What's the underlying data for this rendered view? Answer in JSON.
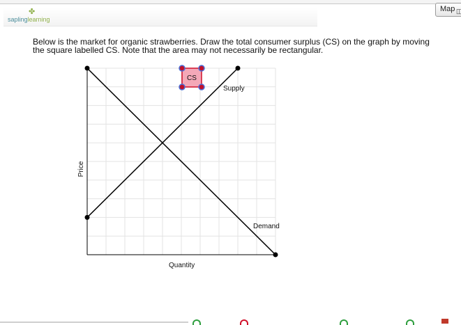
{
  "header": {
    "logo_main": "sapling",
    "logo_accent": "learning",
    "map_button_label": "Map"
  },
  "question": {
    "text": "Below is the market for organic strawberries. Draw the total consumer surplus (CS) on the graph by moving the square labelled CS. Note that the area may not necessarily be rectangular."
  },
  "graph": {
    "x_axis_label": "Quantity",
    "y_axis_label": "Price",
    "supply_label": "Supply",
    "demand_label": "Demand",
    "cs_label": "CS",
    "grid_divisions": 10,
    "supply_endpoints": [
      [
        0,
        2
      ],
      [
        8,
        10
      ]
    ],
    "demand_endpoints": [
      [
        0,
        10
      ],
      [
        10,
        0
      ]
    ],
    "colors": {
      "grid": "#e3e3e3",
      "line": "#000000",
      "cs_fill": "#f4a8b8",
      "cs_border": "#d0102a",
      "handle_fill": "#c0102a",
      "handle_ring": "#4a6fd8"
    }
  },
  "footer": {
    "colors": [
      "#2e9e3e",
      "#d0102a",
      "#2e9e3e",
      "#2e9e3e"
    ]
  }
}
